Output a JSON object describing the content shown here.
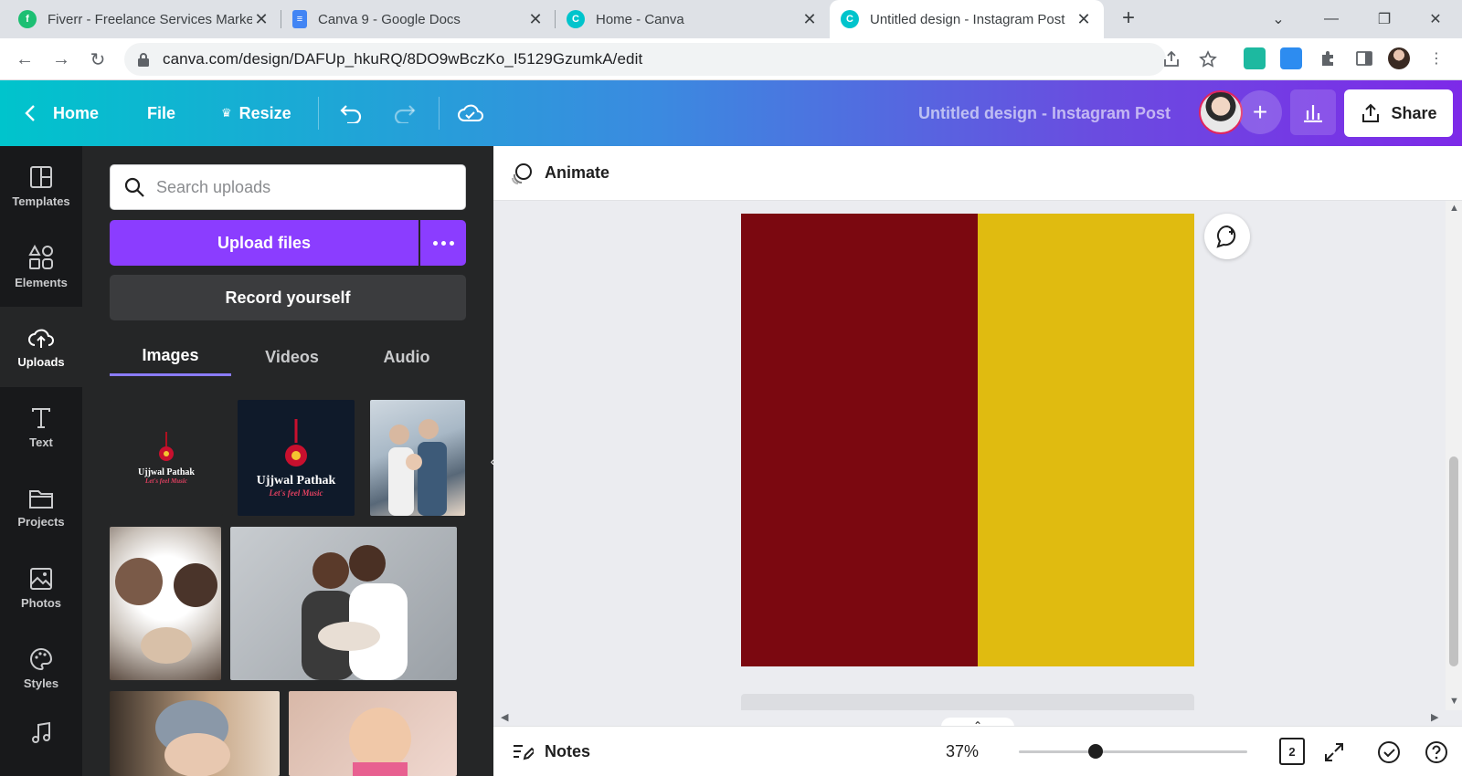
{
  "browser": {
    "tabs": [
      {
        "title": "Fiverr - Freelance Services Marketplace",
        "icon": "fiverr-icon",
        "active": false
      },
      {
        "title": "Canva 9 - Google Docs",
        "icon": "google-docs-icon",
        "active": false
      },
      {
        "title": "Home - Canva",
        "icon": "canva-icon",
        "active": false
      },
      {
        "title": "Untitled design - Instagram Post",
        "icon": "canva-icon",
        "active": true
      }
    ],
    "url": "canva.com/design/DAFUp_hkuRQ/8DO9wBczKo_I5129GzumkA/edit"
  },
  "topbar": {
    "home": "Home",
    "file": "File",
    "resize": "Resize",
    "design_title": "Untitled design - Instagram Post",
    "share": "Share"
  },
  "rail": [
    {
      "label": "Templates",
      "icon": "templates-icon"
    },
    {
      "label": "Elements",
      "icon": "elements-icon"
    },
    {
      "label": "Uploads",
      "icon": "uploads-icon",
      "active": true
    },
    {
      "label": "Text",
      "icon": "text-icon"
    },
    {
      "label": "Projects",
      "icon": "projects-icon"
    },
    {
      "label": "Photos",
      "icon": "photos-icon"
    },
    {
      "label": "Styles",
      "icon": "styles-icon"
    }
  ],
  "uploads": {
    "search_placeholder": "Search uploads",
    "upload_button": "Upload files",
    "record_button": "Record yourself",
    "tabs": [
      "Images",
      "Videos",
      "Audio"
    ],
    "logo_text": "Ujjwal Pathak",
    "logo_tagline": "Let's feel Music"
  },
  "editor": {
    "animate": "Animate",
    "notes": "Notes",
    "zoom": "37%",
    "page_count": "2"
  },
  "colors": {
    "design_left": "#7b0810",
    "design_right": "#e0bb10",
    "accent": "#8b3dff"
  }
}
